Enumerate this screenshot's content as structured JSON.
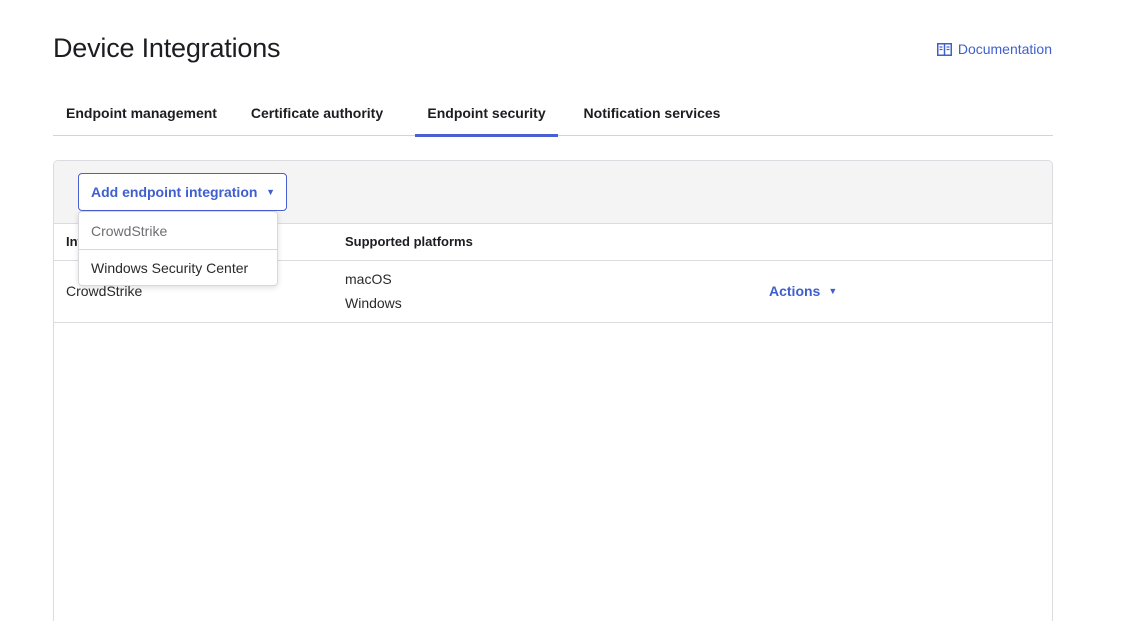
{
  "page": {
    "title": "Device Integrations",
    "documentation_label": "Documentation"
  },
  "tabs": [
    {
      "label": "Endpoint management",
      "active": false
    },
    {
      "label": "Certificate authority",
      "active": false
    },
    {
      "label": "Endpoint security",
      "active": true
    },
    {
      "label": "Notification services",
      "active": false
    }
  ],
  "toolbar": {
    "add_label": "Add endpoint integration"
  },
  "dropdown": {
    "items": [
      {
        "label": "CrowdStrike",
        "disabled": true
      },
      {
        "label": "Windows Security Center",
        "disabled": false
      }
    ]
  },
  "table": {
    "columns": [
      "Integration",
      "Supported platforms"
    ],
    "rows": [
      {
        "integration": "CrowdStrike",
        "platforms": [
          "macOS",
          "Windows"
        ],
        "actions_label": "Actions"
      }
    ]
  },
  "colors": {
    "accent": "#4a5fd1",
    "link": "#3f5fce"
  }
}
